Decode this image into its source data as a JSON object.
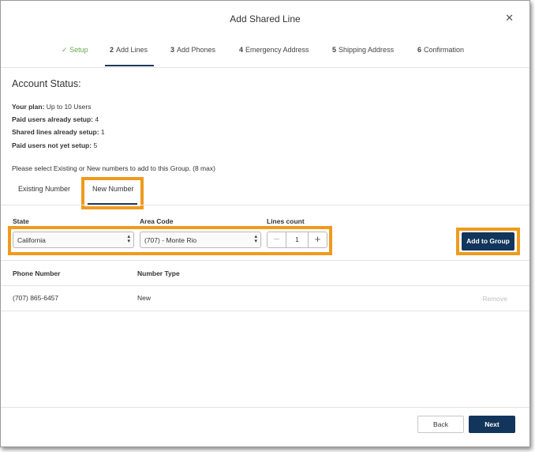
{
  "dialog": {
    "title": "Add Shared Line",
    "close_glyph": "✕"
  },
  "steps": [
    {
      "num": "✓",
      "label": "Setup",
      "state": "done"
    },
    {
      "num": "2",
      "label": "Add Lines",
      "state": "active"
    },
    {
      "num": "3",
      "label": "Add Phones",
      "state": "pending"
    },
    {
      "num": "4",
      "label": "Emergency Address",
      "state": "pending"
    },
    {
      "num": "5",
      "label": "Shipping Address",
      "state": "pending"
    },
    {
      "num": "6",
      "label": "Confirmation",
      "state": "pending"
    }
  ],
  "account": {
    "title": "Account Status:",
    "lines": [
      {
        "label": "Your plan:",
        "value": "Up to 10 Users"
      },
      {
        "label": "Paid users already setup:",
        "value": "4"
      },
      {
        "label": "Shared lines already setup:",
        "value": "1"
      },
      {
        "label": "Paid users not yet setup:",
        "value": "5"
      }
    ]
  },
  "instruction": "Please select Existing or New numbers to add to this Group. (8 max)",
  "tabs": {
    "existing": "Existing Number",
    "new": "New Number",
    "active": "new"
  },
  "form": {
    "state_label": "State",
    "state_value": "California",
    "area_label": "Area Code",
    "area_value": "(707) - Monte Rio",
    "lines_label": "Lines count",
    "lines_value": "1",
    "minus": "−",
    "plus": "+",
    "add_button": "Add to Group"
  },
  "table": {
    "headers": [
      "Phone Number",
      "Number Type"
    ],
    "rows": [
      {
        "phone": "(707) 865-6457",
        "type": "New",
        "action": "Remove"
      }
    ]
  },
  "footer": {
    "back": "Back",
    "next": "Next"
  },
  "colors": {
    "primary": "#12355b",
    "highlight": "#f09a1d",
    "done_step": "#6aa84f"
  },
  "icons": {
    "close": "close-icon",
    "check": "check-icon",
    "select_arrows": "updown-arrows-icon"
  }
}
